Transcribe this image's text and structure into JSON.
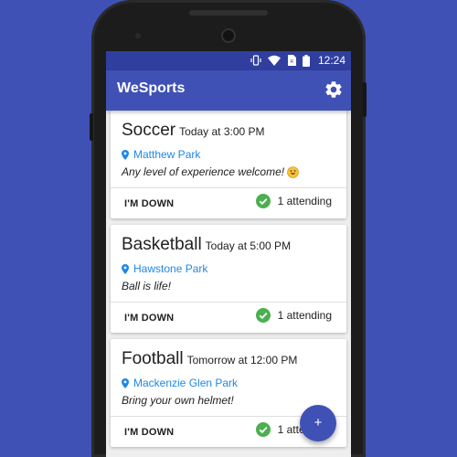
{
  "status_bar": {
    "time": "12:24",
    "icons": [
      "vibrate-icon",
      "wifi-icon",
      "sim-icon",
      "battery-icon"
    ]
  },
  "app_bar": {
    "title": "WeSports",
    "settings_icon": "gear-icon"
  },
  "events": [
    {
      "sport": "Soccer",
      "when": "Today at 3:00 PM",
      "location": "Matthew Park",
      "description": "Any level of experience welcome!",
      "description_emoji": "smile-emoji",
      "action_label": "I'M DOWN",
      "attending": "1 attending"
    },
    {
      "sport": "Basketball",
      "when": "Today at 5:00 PM",
      "location": "Hawstone Park",
      "description": "Ball is life!",
      "action_label": "I'M DOWN",
      "attending": "1 attending"
    },
    {
      "sport": "Football",
      "when": "Tomorrow at 12:00 PM",
      "location": "Mackenzie Glen Park",
      "description": "Bring your own helmet!",
      "action_label": "I'M DOWN",
      "attending": "1 attending"
    }
  ],
  "fab": {
    "label": "+"
  },
  "colors": {
    "background": "#3f51b5",
    "primary": "#3f51b5",
    "primary_dark": "#303f9f",
    "link": "#1e88e5",
    "check": "#4caf50"
  }
}
